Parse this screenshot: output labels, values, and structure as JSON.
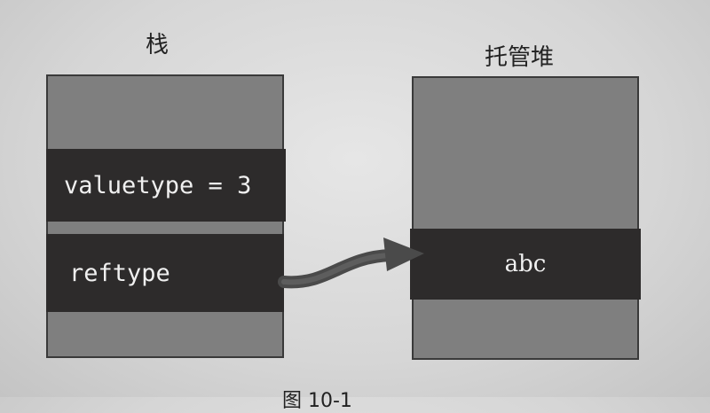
{
  "stack": {
    "title": "栈",
    "value_slot": "valuetype = 3",
    "ref_slot": "reftype"
  },
  "heap": {
    "title": "托管堆",
    "object_value": "abc"
  },
  "caption": "图 10-1",
  "colors": {
    "background": "#d9d9d9",
    "panel": "#7f7f7f",
    "band": "#2d2b2b",
    "text_light": "#f0f0f0",
    "arrow": "#4a4a4a"
  }
}
